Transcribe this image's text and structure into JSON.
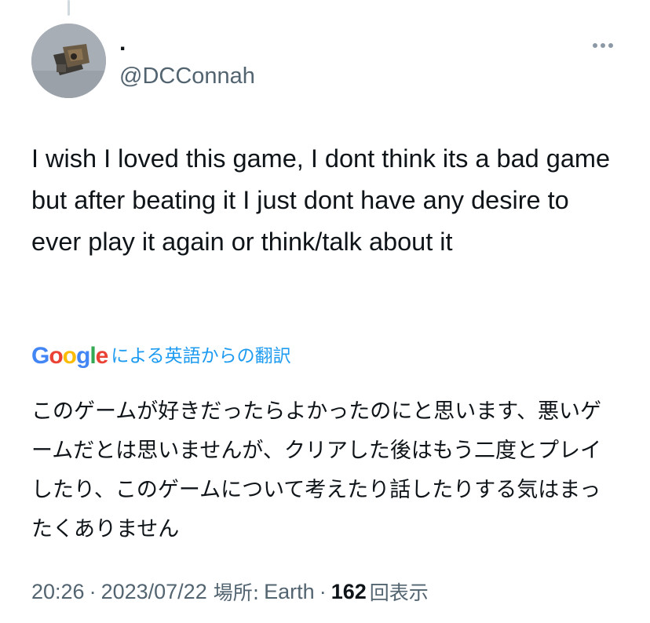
{
  "author": {
    "display_name": ".",
    "handle": "@DCConnah"
  },
  "menu": {
    "more_icon": "more-horizontal-icon"
  },
  "tweet": {
    "text": "I wish I loved this game, I dont think its a bad game but after beating it I just dont have any desire to ever play it again or think/talk about it"
  },
  "translation": {
    "provider_logo": {
      "letters": [
        "G",
        "o",
        "o",
        "g",
        "l",
        "e"
      ],
      "colors": [
        "#4285f4",
        "#ea4335",
        "#fbbc05",
        "#4285f4",
        "#34a853",
        "#ea4335"
      ]
    },
    "label": "による英語からの翻訳",
    "text": "このゲームが好きだったらよかったのにと思います、悪いゲームだとは思いませんが、クリアした後はもう二度とプレイしたり、このゲームについて考えたり話したりする気はまったくありません"
  },
  "meta": {
    "time": "20:26",
    "separator": "·",
    "date": "2023/07/22",
    "location_label": "場所:",
    "location": "Earth",
    "views_count": "162",
    "views_label": "回表示"
  },
  "colors": {
    "text_primary": "#0f1419",
    "text_secondary": "#536471",
    "link_blue": "#1d9bf0"
  }
}
